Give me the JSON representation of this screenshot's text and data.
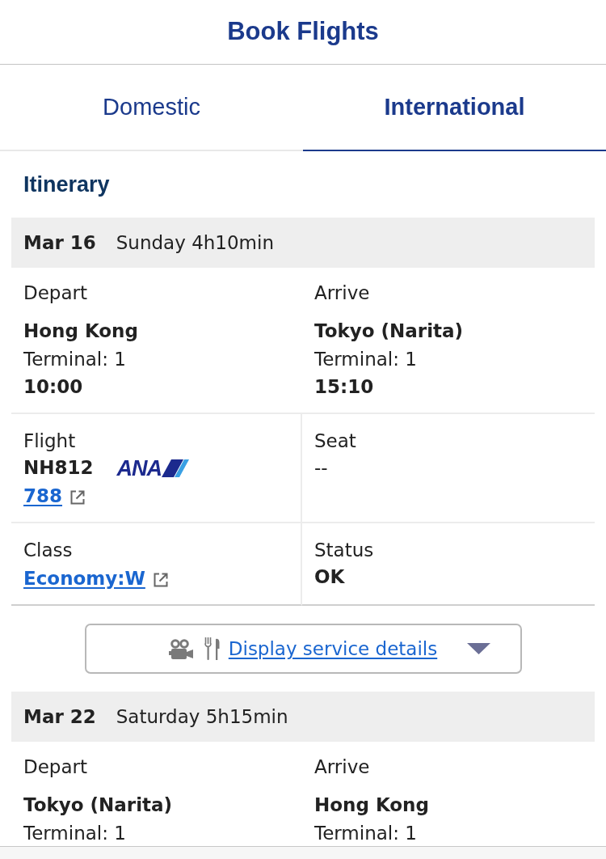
{
  "header": {
    "title": "Book Flights"
  },
  "tabs": [
    {
      "label": "Domestic",
      "selected": false
    },
    {
      "label": "International",
      "selected": true
    }
  ],
  "itinerary": {
    "title": "Itinerary",
    "segments": [
      {
        "date": "Mar 16",
        "day_duration": "Sunday 4h10min",
        "endpoints": [
          {
            "label": "Depart",
            "city": "Hong Kong",
            "terminal": "Terminal: 1",
            "time": "10:00"
          },
          {
            "label": "Arrive",
            "city": "Tokyo (Narita)",
            "terminal": "Terminal: 1",
            "time": "15:10"
          }
        ],
        "details": [
          {
            "kind": "flight",
            "label": "Flight",
            "number": "NH812",
            "airline_logo": "ANA",
            "aircraft_link": "788"
          },
          {
            "kind": "plain",
            "label": "Seat",
            "value": "--"
          },
          {
            "kind": "link",
            "label": "Class",
            "value": "Economy:W"
          },
          {
            "kind": "bold",
            "label": "Status",
            "value": "OK"
          }
        ],
        "service_button": {
          "label": "Display service details"
        }
      },
      {
        "date": "Mar 22",
        "day_duration": "Saturday 5h15min",
        "endpoints": [
          {
            "label": "Depart",
            "city": "Tokyo (Narita)",
            "terminal": "Terminal: 1"
          },
          {
            "label": "Arrive",
            "city": "Hong Kong",
            "terminal": "Terminal: 1"
          }
        ]
      }
    ]
  }
}
